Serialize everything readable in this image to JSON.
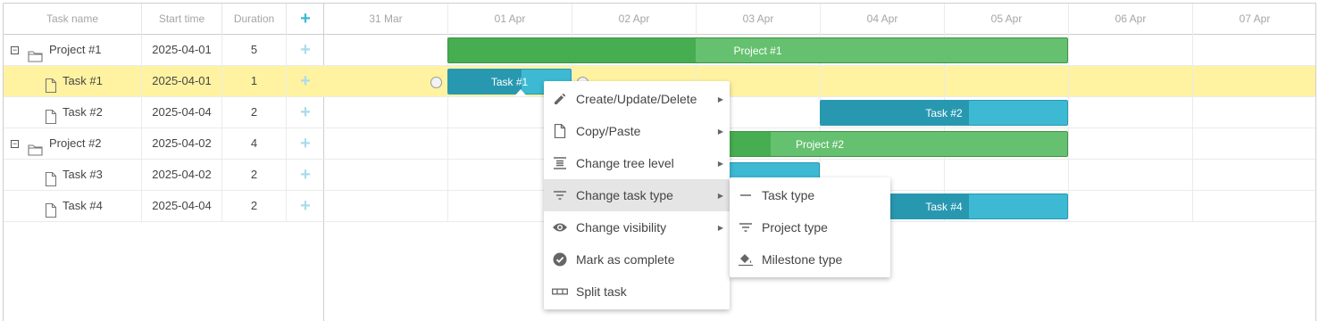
{
  "grid": {
    "headers": {
      "name": "Task name",
      "start": "Start time",
      "duration": "Duration",
      "add": "+"
    },
    "rows": [
      {
        "name": "Project #1",
        "start": "2025-04-01",
        "duration": "5",
        "add": "+",
        "type": "project"
      },
      {
        "name": "Task #1",
        "start": "2025-04-01",
        "duration": "1",
        "add": "+",
        "type": "task"
      },
      {
        "name": "Task #2",
        "start": "2025-04-04",
        "duration": "2",
        "add": "+",
        "type": "task"
      },
      {
        "name": "Project #2",
        "start": "2025-04-02",
        "duration": "4",
        "add": "+",
        "type": "project"
      },
      {
        "name": "Task #3",
        "start": "2025-04-02",
        "duration": "2",
        "add": "+",
        "type": "task"
      },
      {
        "name": "Task #4",
        "start": "2025-04-04",
        "duration": "2",
        "add": "+",
        "type": "task"
      }
    ],
    "toggle_symbol": "−"
  },
  "timeline": {
    "dates": [
      "31 Mar",
      "01 Apr",
      "02 Apr",
      "03 Apr",
      "04 Apr",
      "05 Apr",
      "06 Apr",
      "07 Apr"
    ]
  },
  "bars": {
    "project1": "Project #1",
    "task1": "Task #1",
    "task2": "Task #2",
    "project2": "Project #2",
    "task4": "Task #4"
  },
  "context_menu": {
    "items": [
      {
        "label": "Create/Update/Delete",
        "icon": "pencil-icon"
      },
      {
        "label": "Copy/Paste",
        "icon": "document-icon"
      },
      {
        "label": "Change tree level",
        "icon": "indent-icon"
      },
      {
        "label": "Change task type",
        "icon": "filter-icon"
      },
      {
        "label": "Change visibility",
        "icon": "eye-icon"
      },
      {
        "label": "Mark as complete",
        "icon": "check-circle-icon"
      },
      {
        "label": "Split task",
        "icon": "split-icon"
      }
    ]
  },
  "submenu": {
    "items": [
      {
        "label": "Task type",
        "icon": "minus-icon"
      },
      {
        "label": "Project type",
        "icon": "filter-icon"
      },
      {
        "label": "Milestone type",
        "icon": "paint-bucket-icon"
      }
    ]
  },
  "colors": {
    "project_bar": "#65c16f",
    "project_progress": "#46ad51",
    "task_bar": "#3db9d3",
    "task_progress": "#2898b0",
    "selected_row": "#fff3a1",
    "accent_plus": "#3db9d3"
  }
}
